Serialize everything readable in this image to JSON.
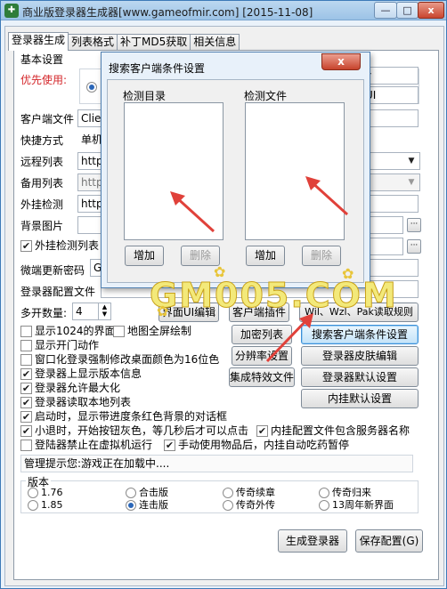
{
  "window": {
    "title": "商业版登录器生成器[www.gameofmir.com] [2015-11-08]",
    "controls": [
      "—",
      "□",
      "x"
    ]
  },
  "tabs": [
    "登录器生成",
    "列表格式",
    "补丁MD5获取",
    "相关信息"
  ],
  "basic": {
    "title": "基本设置",
    "priority_label": "优先使用:",
    "radio_partial": "I",
    "right_frag_1": "y",
    "right_frag_2": "UI"
  },
  "rows": {
    "client_file": {
      "label": "客户端文件",
      "value": "Clie"
    },
    "shortcut": {
      "label": "快捷方式",
      "value": "单机"
    },
    "remote_list": {
      "label": "远程列表",
      "value": "http"
    },
    "backup_list": {
      "label": "备用列表",
      "value": "http"
    },
    "plugin_check": {
      "label": "外挂检测",
      "value": "http"
    },
    "bg_image": {
      "label": "背景图片",
      "value": ""
    },
    "plugin_list": {
      "label": "外挂检测列表",
      "value": ""
    },
    "micro_pwd": {
      "label": "微端更新密码",
      "value": "Ge"
    },
    "config_file": {
      "label": "登录器配置文件",
      "value": ""
    },
    "multi_open": {
      "label": "多开数量:",
      "value": "4"
    }
  },
  "buttons": {
    "ui_edit": "界面UI编辑",
    "client_plugin": "客户端插件",
    "wil_rule": "Wil、Wzl、Pak读取规则",
    "encrypt_list": "加密列表",
    "search_client": "搜索客户端条件设置",
    "resolution": "分辨率设置",
    "skin_edit": "登录器皮肤编辑",
    "effect_file": "集成特效文件",
    "default_settings": "登录器默认设置",
    "plugin_default": "内挂默认设置",
    "generate": "生成登录器",
    "save_config": "保存配置(G)"
  },
  "checkboxes": [
    {
      "label": "显示1024的界面",
      "checked": false
    },
    {
      "label": "地图全屏绘制",
      "checked": false
    },
    {
      "label": "显示开门动作",
      "checked": false
    },
    {
      "label": "窗口化登录强制修改桌面颜色为16位色",
      "checked": false
    },
    {
      "label": "登录器上显示版本信息",
      "checked": true
    },
    {
      "label": "登录器允许最大化",
      "checked": true
    },
    {
      "label": "登录器读取本地列表",
      "checked": true
    },
    {
      "label": "启动时，显示带进度条红色背景的对话框",
      "checked": true
    },
    {
      "label": "小退时，开始按钮灰色，等几秒后才可以点击",
      "checked": true
    },
    {
      "label": "内挂配置文件包含服务器名称",
      "checked": true
    },
    {
      "label": "登陆器禁止在虚拟机运行",
      "checked": false
    },
    {
      "label": "手动使用物品后，内挂自动吃药暂停",
      "checked": true
    }
  ],
  "admin_tip": {
    "label": "管理提示您:",
    "message": "游戏正在加载中...."
  },
  "version": {
    "title": "版本",
    "options": [
      {
        "label": "1.76",
        "selected": false
      },
      {
        "label": "合击版",
        "selected": false
      },
      {
        "label": "传奇续章",
        "selected": false
      },
      {
        "label": "传奇归来",
        "selected": false
      },
      {
        "label": "1.85",
        "selected": false
      },
      {
        "label": "连击版",
        "selected": true
      },
      {
        "label": "传奇外传",
        "selected": false
      },
      {
        "label": "13周年新界面",
        "selected": false
      }
    ]
  },
  "dialog": {
    "title": "搜索客户端条件设置",
    "close": "x",
    "left_group": "检测目录",
    "right_group": "检测文件",
    "add": "增加",
    "delete": "删除"
  },
  "watermark": {
    "text": "GM005.COM"
  },
  "colors": {
    "accent_red": "#d4262a",
    "watermark": "#f3e97a",
    "arrow": "#e0413a"
  }
}
